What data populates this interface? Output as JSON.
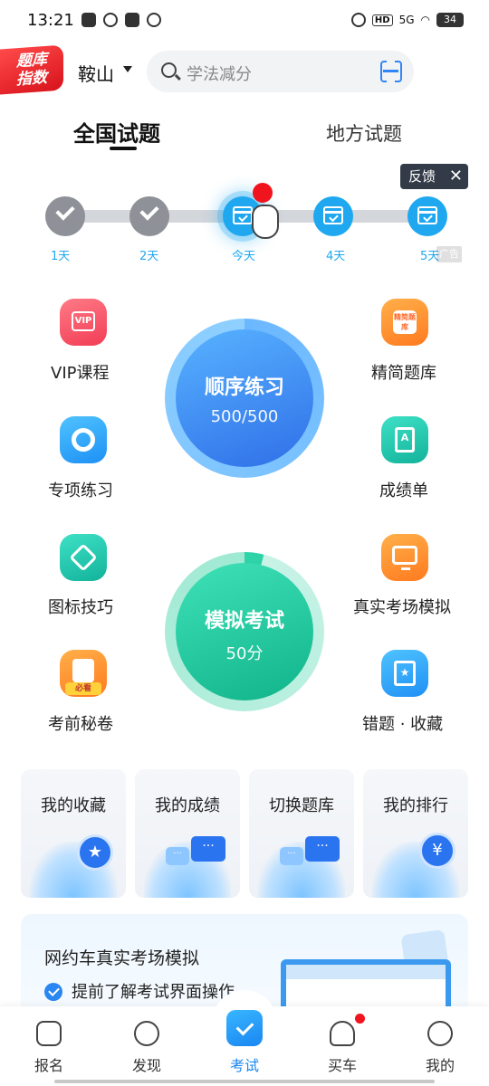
{
  "status_bar": {
    "time": "13:21",
    "network": "5G",
    "battery": "34",
    "hd": "HD"
  },
  "header": {
    "logo_text": "题库\n指数",
    "logo_line1": "题库",
    "logo_line2": "指数",
    "city": "鞍山",
    "search_placeholder": "学法减分"
  },
  "tabs": {
    "national": "全国试题",
    "local": "地方试题"
  },
  "feedback": {
    "label": "反馈",
    "close": "✕"
  },
  "checkin": {
    "days": [
      {
        "label": "1天",
        "state": "done"
      },
      {
        "label": "2天",
        "state": "done"
      },
      {
        "label": "今天",
        "state": "today"
      },
      {
        "label": "4天",
        "state": "future"
      },
      {
        "label": "5天",
        "state": "future"
      }
    ],
    "ad_tag": "广告"
  },
  "features_left": [
    {
      "label": "VIP课程",
      "icon": "vip-icon",
      "icon_text": "VIP"
    },
    {
      "label": "专项练习",
      "icon": "target-icon"
    },
    {
      "label": "图标技巧",
      "icon": "sign-icon"
    },
    {
      "label": "考前秘卷",
      "icon": "exam-paper-icon",
      "badge": "必看"
    }
  ],
  "features_right": [
    {
      "label": "精简题库",
      "icon": "note-icon",
      "icon_text": "精简题库"
    },
    {
      "label": "成绩单",
      "icon": "report-icon",
      "icon_text": "A"
    },
    {
      "label": "真实考场模拟",
      "icon": "monitor-icon"
    },
    {
      "label": "错题 · 收藏",
      "icon": "bookmark-icon",
      "icon_text": "★"
    }
  ],
  "practice": {
    "title": "顺序练习",
    "progress": "500/500",
    "progress_fraction": 1.0
  },
  "exam": {
    "title": "模拟考试",
    "score": "50分"
  },
  "cards": [
    {
      "label": "我的收藏",
      "art": "star-icon",
      "art_text": "★"
    },
    {
      "label": "我的成绩",
      "art": "chat-icon",
      "art_text": "···"
    },
    {
      "label": "切换题库",
      "art": "chat-icon",
      "art_text": "···"
    },
    {
      "label": "我的排行",
      "art": "yen-icon",
      "art_text": "¥"
    }
  ],
  "banner": {
    "title": "网约车真实考场模拟",
    "point": "提前了解考试界面操作"
  },
  "bottom_nav": [
    {
      "label": "报名",
      "icon": "form-icon"
    },
    {
      "label": "发现",
      "icon": "compass-icon"
    },
    {
      "label": "考试",
      "icon": "exam-icon",
      "active": true
    },
    {
      "label": "买车",
      "icon": "car-icon",
      "dot": true
    },
    {
      "label": "我的",
      "icon": "profile-icon"
    }
  ],
  "colors": {
    "accent": "#1a86f2",
    "practice_gradient": [
      "#58b3ff",
      "#2f6fe8"
    ],
    "exam_gradient": [
      "#3fe1b8",
      "#11b48a"
    ],
    "done_grey": "#8e9197"
  }
}
